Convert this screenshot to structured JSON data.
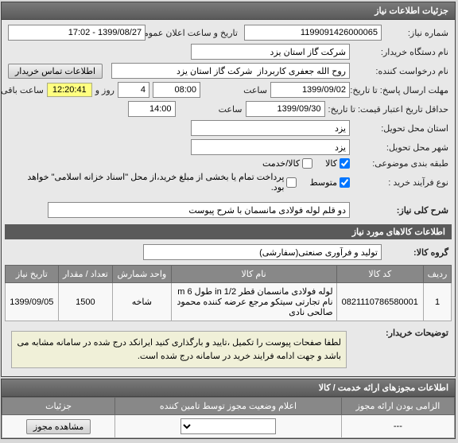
{
  "main_panel": {
    "title": "جزئیات اطلاعات نیاز"
  },
  "fields": {
    "need_number_label": "شماره نیاز:",
    "need_number": "1199091426000065",
    "announce_datetime_label": "تاریخ و ساعت اعلان عمومی:",
    "announce_datetime": "1399/08/27 - 17:02",
    "buyer_org_label": "نام دستگاه خریدار:",
    "buyer_org": "شرکت گاز استان یزد",
    "requester_label": "نام درخواست کننده:",
    "requester": "روح الله جعفری کاربرداز  شرکت گاز استان یزد",
    "buyer_contact_btn": "اطلاعات تماس خریدار",
    "response_deadline_label": "مهلت ارسال پاسخ: تا تاریخ:",
    "response_date": "1399/09/02",
    "time_label": "ساعت",
    "response_time": "08:00",
    "days_label": "روز و",
    "days_value": "4",
    "timer": "12:20:41",
    "remaining_label": "ساعت باقی مانده",
    "price_validity_label": "حداقل تاریخ اعتبار قیمت: تا تاریخ:",
    "price_date": "1399/09/30",
    "price_time": "14:00",
    "delivery_province_label": "استان محل تحویل:",
    "delivery_province": "یزد",
    "delivery_city_label": "شهر محل تحویل:",
    "delivery_city": "یزد",
    "budget_label": "طبقه بندی موضوعی:",
    "goods_label": "کالا",
    "service_label": "کالا/خدمت",
    "process_type_label": "نوع فرآیند خرید :",
    "medium_label": "متوسط",
    "payment_note": "پرداخت تمام یا بخشی از مبلغ خرید،از محل \"اسناد خزانه اسلامی\" خواهد بود.",
    "summary_label": "شرح کلی نیاز:",
    "summary": "دو قلم لوله فولادی مانسمان با شرح پیوست"
  },
  "items_section": {
    "title": "اطلاعات کالاهای مورد نیاز",
    "group_label": "گروه کالا:",
    "group_value": "تولید و فرآوری صنعتی(سفارشی)"
  },
  "table": {
    "headers": {
      "row": "ردیف",
      "code": "کد کالا",
      "name": "نام کالا",
      "unit": "واحد شمارش",
      "qty": "تعداد / مقدار",
      "date": "تاریخ نیاز"
    },
    "rows": [
      {
        "row": "1",
        "code": "0821110786580001",
        "name": "لوله فولادی مانسمان قطر 1/2 in طول 6 m نام تجارتی سیتکو مرجع عرضه کننده محمود صالحی نادی",
        "unit": "شاخه",
        "qty": "1500",
        "date": "1399/09/05"
      }
    ]
  },
  "buyer_notes": {
    "label": "توضیحات خریدار:",
    "text": "لطفا صفحات پیوست را تکمیل ،تایید و بارگذاری کنید ایرانکد درج شده در سامانه مشابه می باشد و جهت ادامه فرایند خرید در سامانه درج شده است."
  },
  "permissions_panel": {
    "title": "اطلاعات مجوزهای ارائه خدمت / کالا",
    "table_headers": {
      "required": "الزامی بودن ارائه مجوز",
      "status": "اعلام وضعیت مجوز توسط تامین کننده",
      "details": "جزئیات"
    },
    "view_btn": "مشاهده مجوز",
    "dash": "---"
  }
}
